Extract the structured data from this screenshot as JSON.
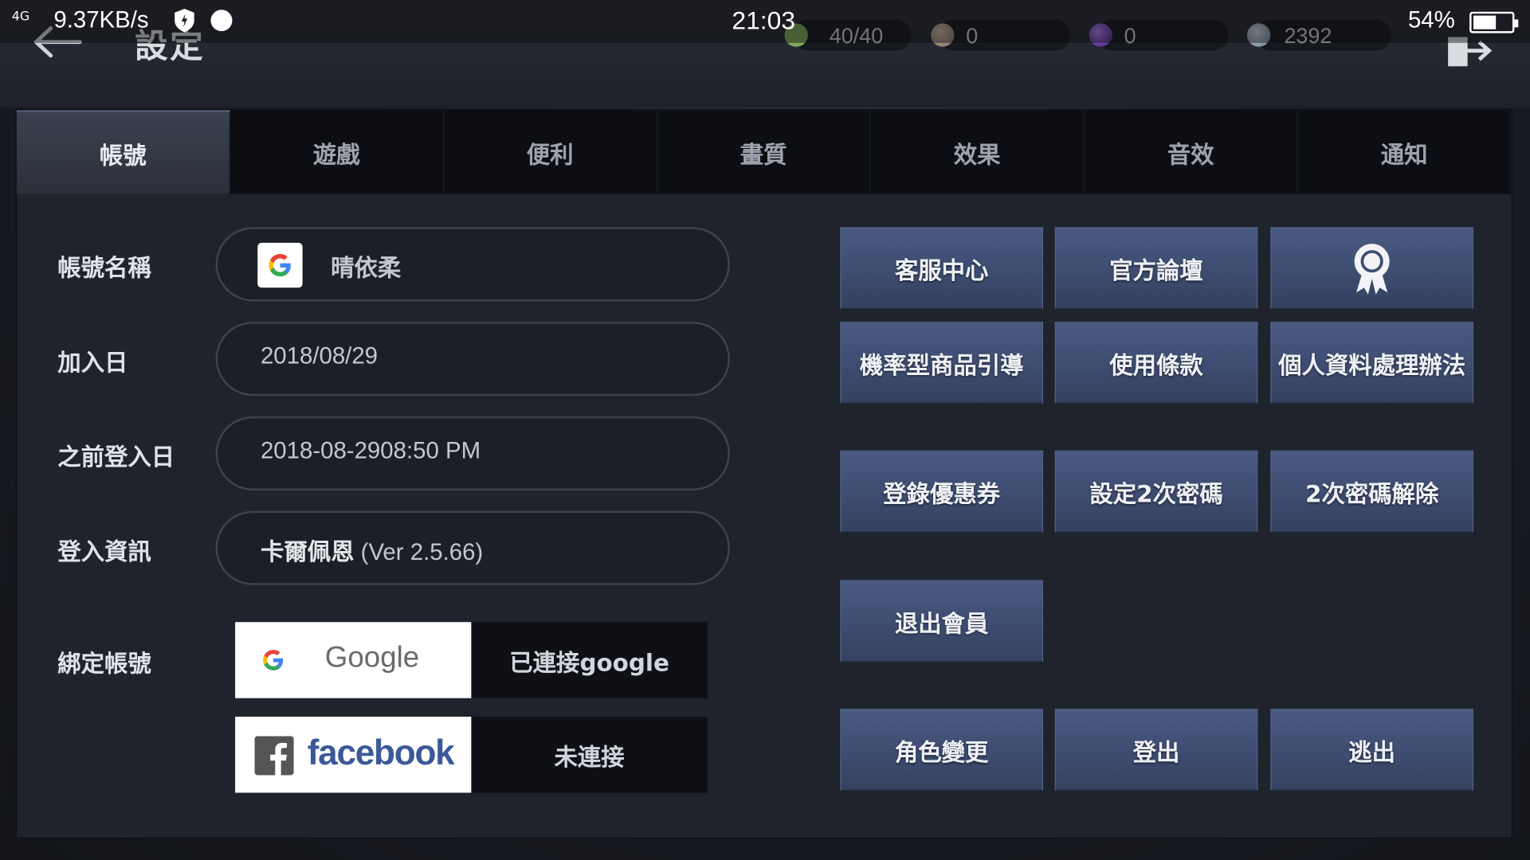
{
  "statusbar": {
    "signal": "4G",
    "speed": "9.37KB/s",
    "time": "21:03",
    "battery_pct": "54%",
    "battery_level": 0.54
  },
  "header": {
    "title": "設定",
    "currencies": [
      {
        "value": "40/40",
        "icon": "stamina-icon",
        "color": "#7fa85a"
      },
      {
        "value": "0",
        "icon": "bronze-coin-icon",
        "color": "#9a8a7c"
      },
      {
        "value": "0",
        "icon": "purple-gem-icon",
        "color": "#6a3cc0"
      },
      {
        "value": "2392",
        "icon": "silver-coin-icon",
        "color": "#8fa0b0"
      }
    ]
  },
  "tabs": [
    "帳號",
    "遊戲",
    "便利",
    "畫質",
    "效果",
    "音效",
    "通知"
  ],
  "account": {
    "name_label": "帳號名稱",
    "name_value": "晴依柔",
    "join_label": "加入日",
    "join_value": "2018/08/29",
    "last_login_label": "之前登入日",
    "last_login_value": "2018-08-2908:50 PM",
    "login_info_label": "登入資訊",
    "login_info_server": "卡爾佩恩",
    "login_info_version": "(Ver 2.5.66)",
    "bind_label": "綁定帳號",
    "google_button": "Google",
    "google_status": "已連接google",
    "facebook_button": "facebook",
    "facebook_status": "未連接"
  },
  "buttons": {
    "support": "客服中心",
    "forum": "官方論壇",
    "probability": "機率型商品引導",
    "terms": "使用條款",
    "privacy": "個人資料處理辦法",
    "coupon": "登錄優惠券",
    "set_password": "設定2次密碼",
    "remove_password": "2次密碼解除",
    "withdraw": "退出會員",
    "change_character": "角色變更",
    "logout": "登出",
    "escape": "逃出"
  }
}
